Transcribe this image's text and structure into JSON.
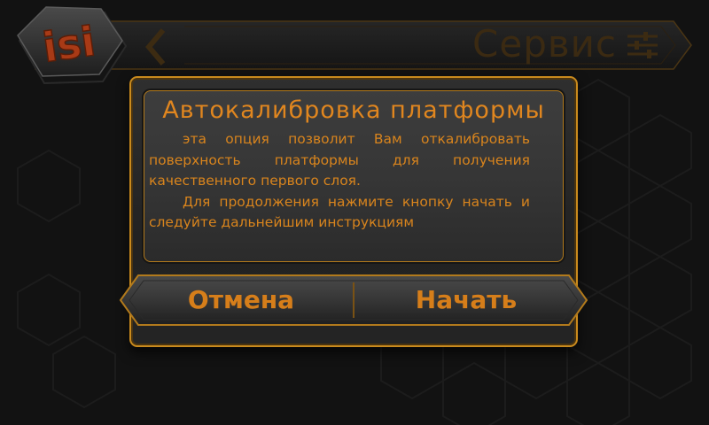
{
  "header": {
    "logo_text": "isi",
    "title": "Сервис"
  },
  "dialog": {
    "title": "Автокалибровка платформы",
    "paragraphs": [
      "эта опция позволит Вам откалибровать поверхность платформы для получения качественного первого слоя.",
      "Для продолжения нажмите кнопку начать и следуйте дальнейшим инструкциям"
    ],
    "cancel_label": "Отмена",
    "start_label": "Начать"
  },
  "colors": {
    "accent": "#d67e1a",
    "border": "#c98a1d",
    "background": "#121212",
    "header_title": "#3b2a12"
  },
  "icons": {
    "back": "chevron-left-icon",
    "menu": "sliders-icon",
    "logo": "isi-logo"
  }
}
